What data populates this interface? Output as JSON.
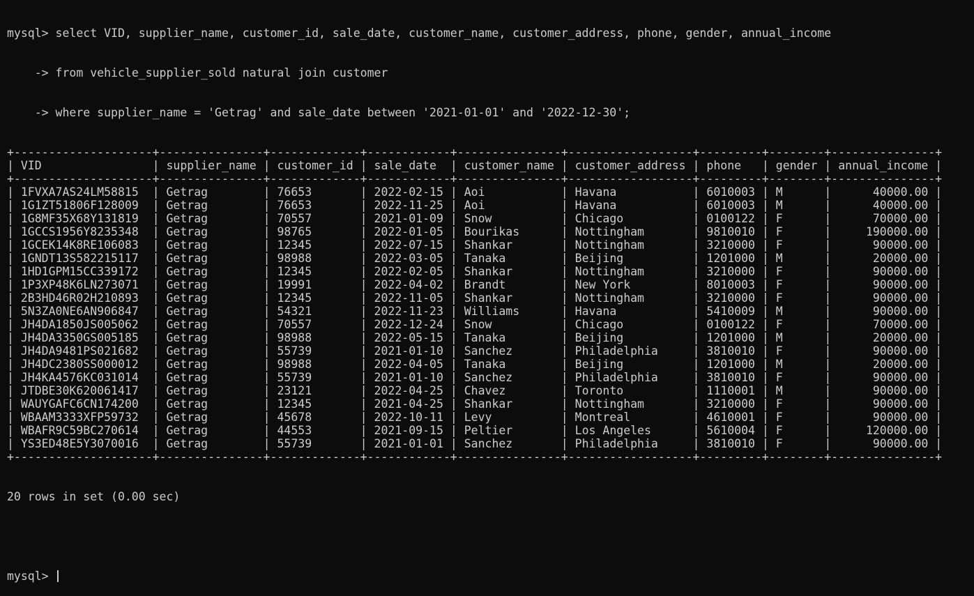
{
  "prompt": "mysql>",
  "continuation_prompt": "    ->",
  "query_lines": [
    "select VID, supplier_name, customer_id, sale_date, customer_name, customer_address, phone, gender, annual_income",
    "from vehicle_supplier_sold natural join customer",
    "where supplier_name = 'Getrag' and sale_date between '2021-01-01' and '2022-12-30';"
  ],
  "columns": [
    "VID",
    "supplier_name",
    "customer_id",
    "sale_date",
    "customer_name",
    "customer_address",
    "phone",
    "gender",
    "annual_income"
  ],
  "column_widths": [
    18,
    13,
    11,
    10,
    13,
    16,
    7,
    6,
    13
  ],
  "right_aligned_columns": [
    8
  ],
  "rows": [
    [
      "1FVXA7AS24LM58815",
      "Getrag",
      "76653",
      "2022-02-15",
      "Aoi",
      "Havana",
      "6010003",
      "M",
      "40000.00"
    ],
    [
      "1G1ZT51806F128009",
      "Getrag",
      "76653",
      "2022-11-25",
      "Aoi",
      "Havana",
      "6010003",
      "M",
      "40000.00"
    ],
    [
      "1G8MF35X68Y131819",
      "Getrag",
      "70557",
      "2021-01-09",
      "Snow",
      "Chicago",
      "0100122",
      "F",
      "70000.00"
    ],
    [
      "1GCCS1956Y8235348",
      "Getrag",
      "98765",
      "2022-01-05",
      "Bourikas",
      "Nottingham",
      "9810010",
      "F",
      "190000.00"
    ],
    [
      "1GCEK14K8RE106083",
      "Getrag",
      "12345",
      "2022-07-15",
      "Shankar",
      "Nottingham",
      "3210000",
      "F",
      "90000.00"
    ],
    [
      "1GNDT13S582215117",
      "Getrag",
      "98988",
      "2022-03-05",
      "Tanaka",
      "Beijing",
      "1201000",
      "M",
      "20000.00"
    ],
    [
      "1HD1GPM15CC339172",
      "Getrag",
      "12345",
      "2022-02-05",
      "Shankar",
      "Nottingham",
      "3210000",
      "F",
      "90000.00"
    ],
    [
      "1P3XP48K6LN273071",
      "Getrag",
      "19991",
      "2022-04-02",
      "Brandt",
      "New York",
      "8010003",
      "F",
      "90000.00"
    ],
    [
      "2B3HD46R02H210893",
      "Getrag",
      "12345",
      "2022-11-05",
      "Shankar",
      "Nottingham",
      "3210000",
      "F",
      "90000.00"
    ],
    [
      "5N3ZA0NE6AN906847",
      "Getrag",
      "54321",
      "2022-11-23",
      "Williams",
      "Havana",
      "5410009",
      "M",
      "90000.00"
    ],
    [
      "JH4DA1850JS005062",
      "Getrag",
      "70557",
      "2022-12-24",
      "Snow",
      "Chicago",
      "0100122",
      "F",
      "70000.00"
    ],
    [
      "JH4DA3350GS005185",
      "Getrag",
      "98988",
      "2022-05-15",
      "Tanaka",
      "Beijing",
      "1201000",
      "M",
      "20000.00"
    ],
    [
      "JH4DA9481PS021682",
      "Getrag",
      "55739",
      "2021-01-10",
      "Sanchez",
      "Philadelphia",
      "3810010",
      "F",
      "90000.00"
    ],
    [
      "JH4DC2380SS000012",
      "Getrag",
      "98988",
      "2022-04-05",
      "Tanaka",
      "Beijing",
      "1201000",
      "M",
      "20000.00"
    ],
    [
      "JH4KA4576KC031014",
      "Getrag",
      "55739",
      "2021-01-10",
      "Sanchez",
      "Philadelphia",
      "3810010",
      "F",
      "90000.00"
    ],
    [
      "JTDBE30K620061417",
      "Getrag",
      "23121",
      "2022-04-25",
      "Chavez",
      "Toronto",
      "1110001",
      "M",
      "90000.00"
    ],
    [
      "WAUYGAFC6CN174200",
      "Getrag",
      "12345",
      "2021-04-25",
      "Shankar",
      "Nottingham",
      "3210000",
      "F",
      "90000.00"
    ],
    [
      "WBAAM3333XFP59732",
      "Getrag",
      "45678",
      "2022-10-11",
      "Levy",
      "Montreal",
      "4610001",
      "F",
      "90000.00"
    ],
    [
      "WBAFR9C59BC270614",
      "Getrag",
      "44553",
      "2021-09-15",
      "Peltier",
      "Los Angeles",
      "5610004",
      "F",
      "120000.00"
    ],
    [
      "YS3ED48E5Y3070016",
      "Getrag",
      "55739",
      "2021-01-01",
      "Sanchez",
      "Philadelphia",
      "3810010",
      "F",
      "90000.00"
    ]
  ],
  "summary": "20 rows in set (0.00 sec)",
  "colors": {
    "background": "#0c0c0c",
    "foreground": "#cccccc"
  }
}
